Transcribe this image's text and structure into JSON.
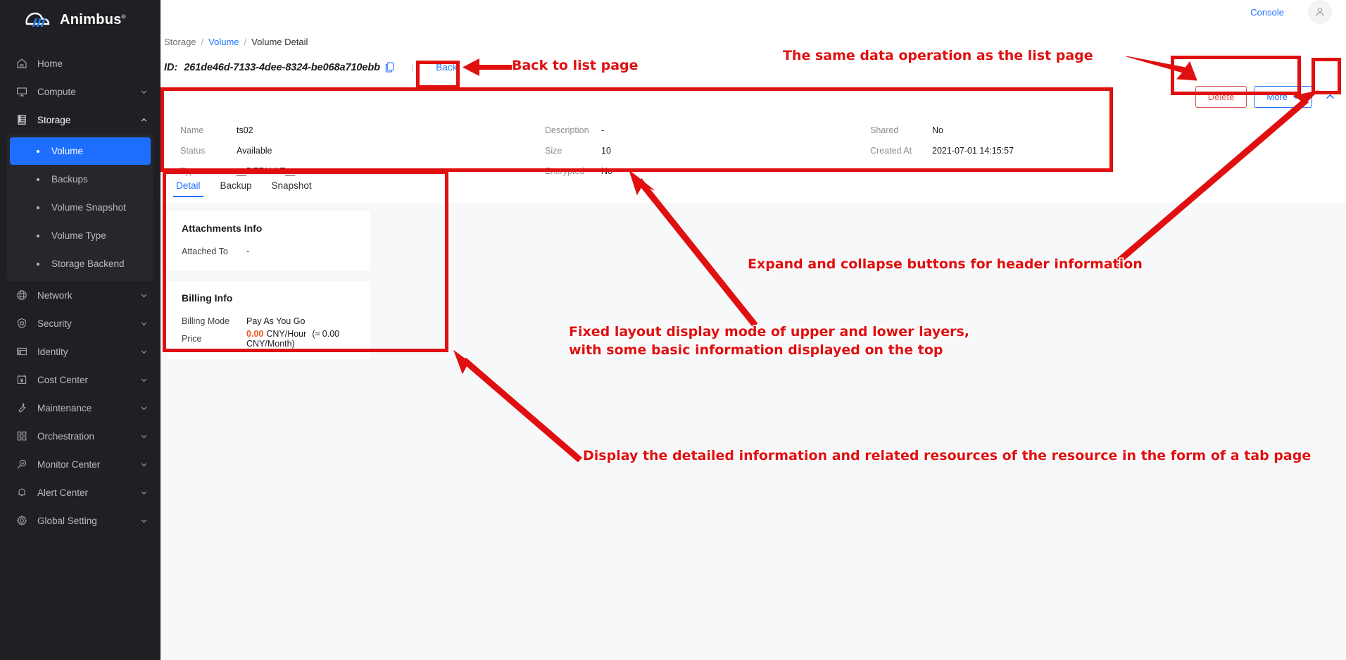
{
  "brand": {
    "name": "Animbus",
    "trademark": "®"
  },
  "topbar": {
    "console_label": "Console",
    "avatar": "user-avatar-icon"
  },
  "sidebar": {
    "items": [
      {
        "label": "Home",
        "icon": "home-icon",
        "expandable": false
      },
      {
        "label": "Compute",
        "icon": "monitor-icon",
        "expandable": true,
        "state": "collapsed"
      },
      {
        "label": "Storage",
        "icon": "storage-icon",
        "expandable": true,
        "state": "expanded"
      },
      {
        "label": "Network",
        "icon": "globe-icon",
        "expandable": true,
        "state": "collapsed"
      },
      {
        "label": "Security",
        "icon": "shield-icon",
        "expandable": true,
        "state": "collapsed"
      },
      {
        "label": "Identity",
        "icon": "id-card-icon",
        "expandable": true,
        "state": "collapsed"
      },
      {
        "label": "Cost Center",
        "icon": "cost-calendar-icon",
        "expandable": true,
        "state": "collapsed"
      },
      {
        "label": "Maintenance",
        "icon": "wrench-icon",
        "expandable": true,
        "state": "collapsed"
      },
      {
        "label": "Orchestration",
        "icon": "grid-blocks-icon",
        "expandable": true,
        "state": "collapsed"
      },
      {
        "label": "Monitor Center",
        "icon": "magnifier-icon",
        "expandable": true,
        "state": "collapsed"
      },
      {
        "label": "Alert Center",
        "icon": "bell-icon",
        "expandable": true,
        "state": "collapsed"
      },
      {
        "label": "Global Setting",
        "icon": "gear-icon",
        "expandable": true,
        "state": "collapsed"
      }
    ],
    "storage_sub_items": [
      {
        "label": "Volume",
        "selected": true
      },
      {
        "label": "Backups",
        "selected": false
      },
      {
        "label": "Volume Snapshot",
        "selected": false
      },
      {
        "label": "Volume Type",
        "selected": false
      },
      {
        "label": "Storage Backend",
        "selected": false
      }
    ],
    "collapse_toggle": "sidebar-collapse-icon"
  },
  "breadcrumb": {
    "root": "Storage",
    "sep": "/",
    "link": "Volume",
    "current": "Volume Detail"
  },
  "header": {
    "id_label": "ID:",
    "id_value": "261de46d-7133-4dee-8324-be068a710ebb",
    "copy_icon": "copy-icon",
    "divider": "|",
    "back_label": "Back"
  },
  "actions": {
    "delete_label": "Delete",
    "more_label": "More",
    "more_caret": "chevron-down-icon",
    "collapse_label": "chevron-up-icon"
  },
  "info": {
    "col1": [
      {
        "key": "Name",
        "value": "ts02"
      },
      {
        "key": "Status",
        "value": "Available"
      },
      {
        "key": "Type",
        "value": "__DEFAULT__"
      }
    ],
    "col2": [
      {
        "key": "Description",
        "value": "-"
      },
      {
        "key": "Size",
        "value": "10"
      },
      {
        "key": "Encrypted",
        "value": "No"
      }
    ],
    "col3": [
      {
        "key": "Shared",
        "value": "No"
      },
      {
        "key": "Created At",
        "value": "2021-07-01 14:15:57"
      }
    ]
  },
  "tabs": [
    {
      "label": "Detail",
      "active": true
    },
    {
      "label": "Backup",
      "active": false
    },
    {
      "label": "Snapshot",
      "active": false
    }
  ],
  "panels": {
    "attachments": {
      "title": "Attachments Info",
      "rows": [
        {
          "key": "Attached To",
          "value": "-"
        }
      ]
    },
    "billing": {
      "title": "Billing Info",
      "rows": [
        {
          "key": "Billing Mode",
          "value": "Pay As You Go"
        }
      ],
      "price": {
        "key": "Price",
        "amount": "0.00",
        "unit": "CNY/Hour",
        "approx": "(≈ 0.00 CNY/Month)"
      }
    }
  },
  "annotations": [
    {
      "id": "a1",
      "text": "Back to list page"
    },
    {
      "id": "a2",
      "text": "The same data operation as the list page"
    },
    {
      "id": "a3",
      "text": "Expand and collapse buttons for header information"
    },
    {
      "id": "a4line1",
      "text": "Fixed layout display mode of upper and lower layers,"
    },
    {
      "id": "a4line2",
      "text": "with some basic information displayed on the top"
    },
    {
      "id": "a5",
      "text": "Display the detailed information and related resources of the resource in the form of a tab page"
    }
  ],
  "colors": {
    "accent_blue": "#1e6fff",
    "annotation_red": "#e01010",
    "delete_red": "#d9534f",
    "price_orange": "#f25822",
    "sidebar_bg": "#1f2023",
    "panel_bg": "#f7f8f9"
  }
}
